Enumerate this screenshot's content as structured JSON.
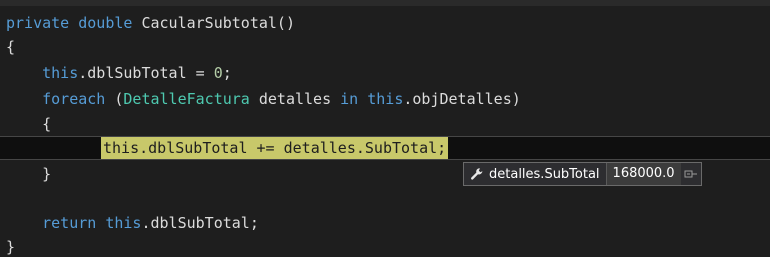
{
  "code": {
    "line1": {
      "kw1": "private",
      "kw2": "double",
      "rest": "CacularSubtotal()"
    },
    "line2": {
      "text": "{"
    },
    "line3": {
      "kw": "this",
      "rest": ".dblSubTotal = ",
      "num": "0",
      "end": ";"
    },
    "line4": {
      "kw1": "foreach",
      "p1": " (",
      "type": "DetalleFactura",
      "p2": " detalles ",
      "kw2": "in",
      "kw3": "this",
      "p3": ".objDetalles)"
    },
    "line5": {
      "text": "{"
    },
    "line6": {
      "stmt": "this.dblSubTotal += detalles.SubTotal;"
    },
    "line7": {
      "text": "}"
    },
    "line8": {
      "kw1": "return",
      "kw2": "this",
      "rest": ".dblSubTotal;"
    },
    "line9": {
      "text": "}"
    }
  },
  "datatip": {
    "icon": "wrench-icon",
    "name": "detalles.SubTotal",
    "value": "168000.0",
    "pin_icon": "pin-icon"
  },
  "colors": {
    "background": "#1e1e1e",
    "keyword": "#569cd6",
    "type": "#4ec9b0",
    "number": "#b5cea8",
    "highlight": "#c8c86a"
  }
}
